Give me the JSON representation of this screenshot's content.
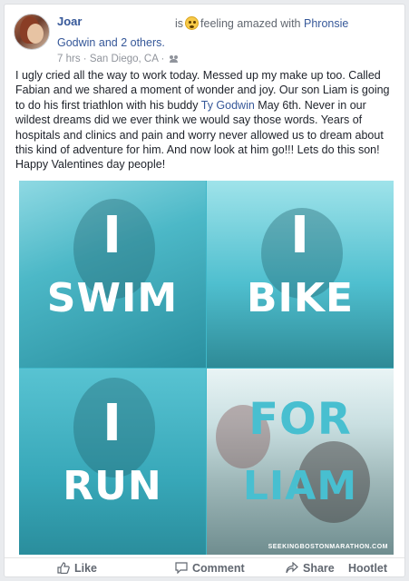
{
  "post": {
    "author": "Joar",
    "feeling_prefix": "is",
    "feeling_text": "feeling amazed with",
    "feeling_with": "Phronsie",
    "tagged_name": "Godwin",
    "tagged_suffix": "and 2 others.",
    "time": "7 hrs",
    "location": "San Diego, CA",
    "text_part1": "I ugly cried all the way to work today. Messed up my make up too. Called Fabian and we shared a moment of wonder and joy. Our son Liam is going to do his first triathlon with his buddy ",
    "text_link": "Ty Godwin",
    "text_part2": " May 6th. Never in our wildest dreams did we ever think we would say those words. Years of hospitals and clinics and pain and worry never allowed us to dream about this kind of adventure for him. And now look at him go!!! Lets do this son! Happy Valentines day people!",
    "icons": {
      "feeling": "amazed-emoji-icon",
      "audience": "friends-icon"
    }
  },
  "photo": {
    "quad1": {
      "line1": "I",
      "line2": "SWIM"
    },
    "quad2": {
      "line1": "I",
      "line2": "BIKE"
    },
    "quad3": {
      "line1": "I",
      "line2": "RUN"
    },
    "quad4": {
      "line1": "FOR",
      "line2": "LIAM"
    },
    "watermark": "SEEKINGBOSTONMARATHON.COM"
  },
  "actions": {
    "like": "Like",
    "comment": "Comment",
    "share": "Share",
    "hootlet": "Hootlet"
  },
  "colors": {
    "link": "#365899",
    "meta": "#90949c",
    "accent_teal": "#48bfd0"
  }
}
